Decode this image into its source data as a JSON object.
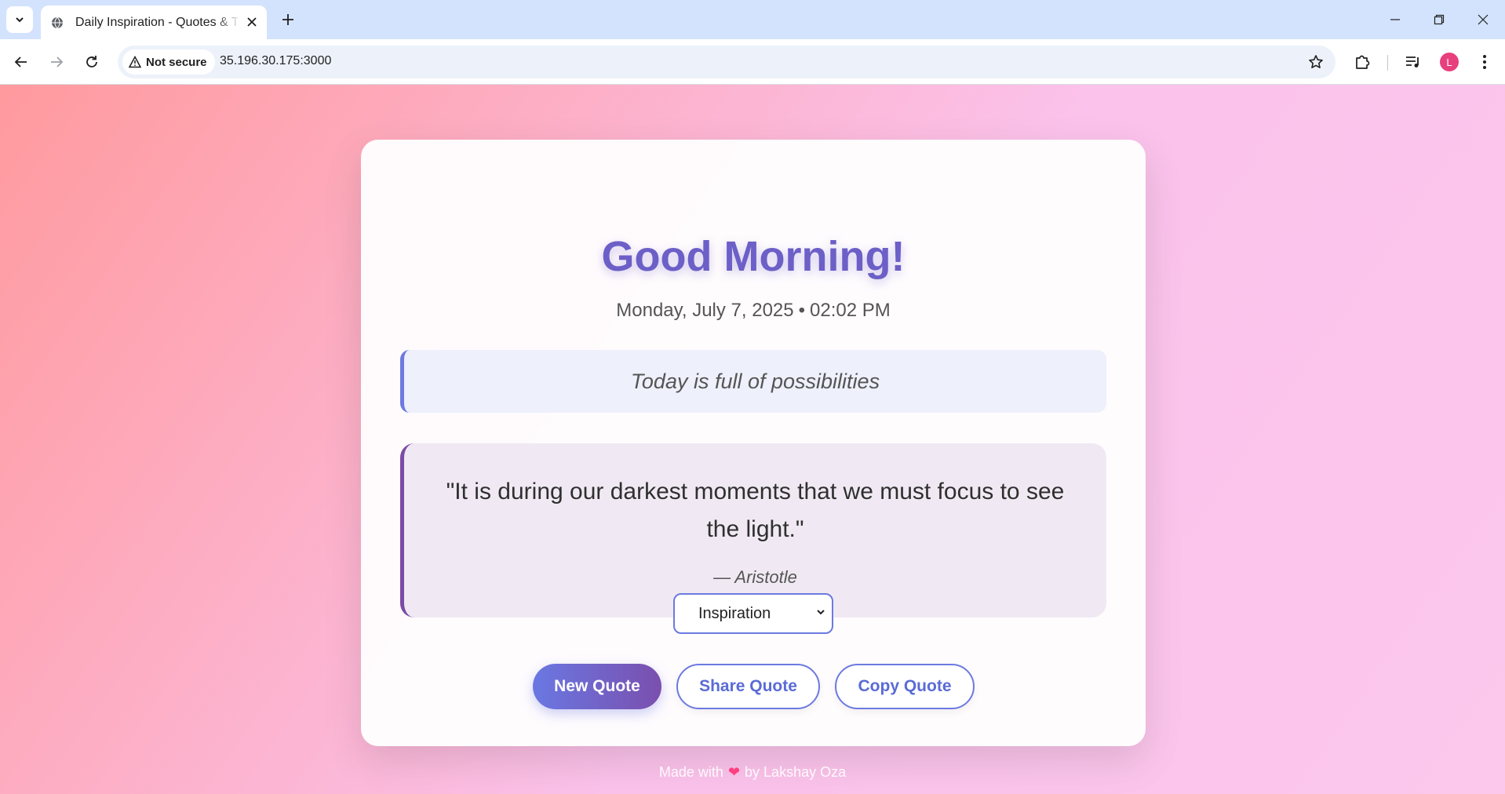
{
  "browser": {
    "tab_title": "Daily Inspiration - Quotes & Thoughts",
    "security_label": "Not secure",
    "url": "35.196.30.175:3000",
    "profile_initial": "L"
  },
  "page": {
    "greeting": "Good Morning!",
    "date": "Monday, July 7, 2025",
    "separator": "•",
    "time": "02:02 PM",
    "affirmation": "Today is full of possibilities",
    "quote_text": "\"It is during our darkest moments that we must focus to see the light.\"",
    "quote_author": "— Aristotle",
    "category_selected": "Inspiration",
    "buttons": {
      "new_quote": "New Quote",
      "share_quote": "Share Quote",
      "copy_quote": "Copy Quote"
    },
    "footer": {
      "prefix": "Made with",
      "heart": "❤",
      "suffix": "by Lakshay Oza"
    }
  },
  "colors": {
    "accent": "#6c7ae0",
    "greeting": "#6c5fc7",
    "background_start": "#ff9a9e",
    "background_end": "#fbc2eb"
  }
}
